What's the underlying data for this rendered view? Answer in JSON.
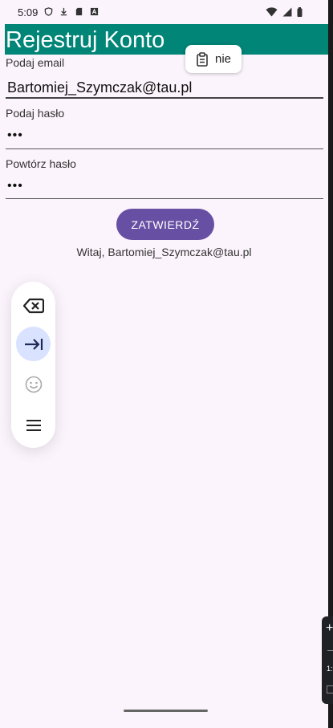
{
  "status_bar": {
    "time": "5:09",
    "left_icons": [
      "shield-icon",
      "download-icon",
      "sd-card-icon",
      "a-badge-icon"
    ],
    "right_icons": [
      "wifi-icon",
      "signal-icon",
      "battery-icon"
    ]
  },
  "app_bar": {
    "title": "Rejestruj Konto",
    "color": "#008577"
  },
  "clipboard_suggestion": {
    "icon": "clipboard-icon",
    "text": "nie"
  },
  "form": {
    "email": {
      "label": "Podaj email",
      "value": "Bartomiej_Szymczak@tau.pl"
    },
    "password": {
      "label": "Podaj hasło",
      "value": "•••"
    },
    "repeat_password": {
      "label": "Powtórz hasło",
      "value": "•••"
    },
    "submit_label": "ZATWIERDŹ",
    "welcome_text": "Witaj, Bartomiej_Szymczak@tau.pl"
  },
  "keyboard_toolbar": {
    "items": [
      "backspace-icon",
      "tab-icon",
      "emoji-icon",
      "menu-icon"
    ]
  },
  "colors": {
    "background": "#fcf4fc",
    "accent": "#6750a4",
    "app_bar": "#008577"
  }
}
